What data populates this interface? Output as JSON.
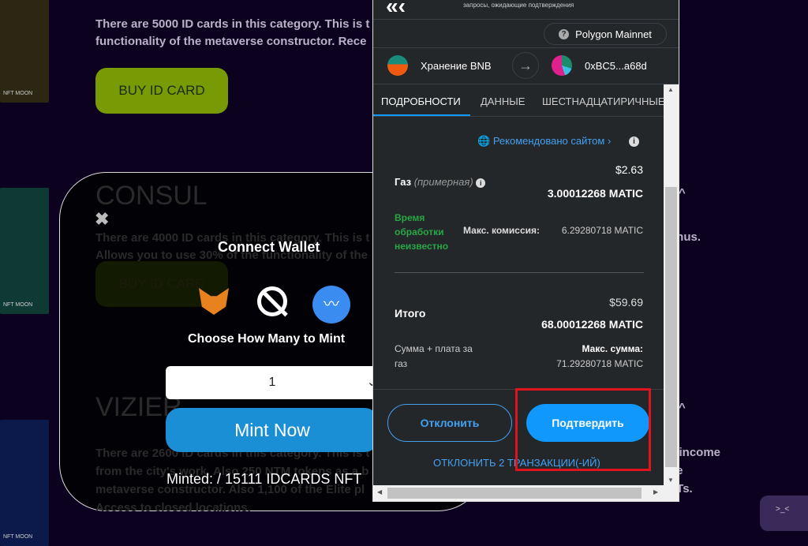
{
  "page": {
    "card_logo": "NFT MOON",
    "section1": {
      "desc_line1": "There are 5000 ID cards in this category. This is t",
      "desc_line2": "functionality of the metaverse constructor. Rece",
      "buy_label": "BUY ID CARD"
    },
    "section2": {
      "title": "CONSUL",
      "desc_line1": "There are 4000 ID cards in this category. This is t",
      "desc_line2": "Allows you to use 30% of the functionality of the",
      "buy_label": "BUY ID CARD",
      "right_fragment": "onus."
    },
    "section3": {
      "title": "VIZIER",
      "desc_line1": "There are 2600 ID cards in this category. This is t",
      "desc_line2": "from the city's work. Also 250 NTM tokens as a b",
      "desc_line3": "metaverse constructor. Also 1,100 of the Elite pl",
      "desc_line4": "Access to closed locations.",
      "right_line1": "e income",
      "right_line2": "ne",
      "right_line3": "FTs."
    },
    "right_top_fragment": "e",
    "caret": "^",
    "widget_face": ">_<"
  },
  "modal": {
    "close": "✖",
    "title": "Connect Wallet",
    "wallets": [
      "metamask-icon",
      "ledger-icon",
      "walletconnect-icon"
    ],
    "choose_label": "Choose How Many to Mint",
    "quantity": "1",
    "mint_label": "Mint Now",
    "minted": "Minted: / 15111 IDCARDS NFT"
  },
  "metamask": {
    "header_sub": "запросы, ожидающие подтверждения",
    "network": "Polygon Mainnet",
    "from": "Хранение BNB",
    "to": "0xBC5...a68d",
    "tabs": [
      "ПОДРОБНОСТИ",
      "ДАННЫЕ",
      "ШЕСТНАДЦАТИРИЧНЫЕ"
    ],
    "recommended": "Рекомендовано сайтом",
    "gas_label": "Газ",
    "gas_estimate": "(примерная)",
    "gas_usd": "$2.63",
    "gas_matic": "3.00012268 MATIC",
    "time_line1": "Время",
    "time_line2": "обработки",
    "time_line3": "неизвестно",
    "max_fee_label": "Макс. комиссия:",
    "max_fee": "6.29280718 MATIC",
    "total_label": "Итого",
    "total_usd": "$59.69",
    "total_matic": "68.00012268 MATIC",
    "sum_line1": "Сумма + плата за",
    "sum_line2": "газ",
    "max_sum_label": "Макс. сумма:",
    "max_sum": "71.29280718 MATIC",
    "reject": "Отклонить",
    "confirm": "Подтвердить",
    "reject_all": "ОТКЛОНИТЬ 2 ТРАНЗАКЦИИ(-ИЙ)"
  },
  "colors": {
    "background": "#0d0120",
    "buy": "#789a04",
    "mint": "#1b8fd6",
    "confirm": "#1098fc",
    "highlight": "#e0141e"
  }
}
